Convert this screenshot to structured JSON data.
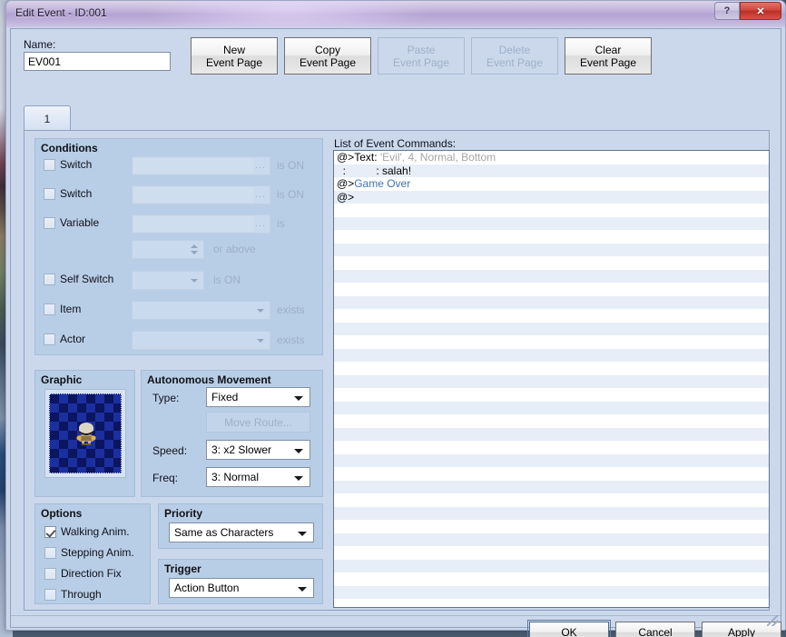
{
  "window": {
    "title": "Edit Event - ID:001",
    "help_button": "?",
    "close_button": "✕"
  },
  "header": {
    "name_label": "Name:",
    "name_value": "EV001",
    "name_placeholder": "",
    "page_buttons": [
      {
        "line1": "New",
        "line2": "Event Page",
        "enabled": true
      },
      {
        "line1": "Copy",
        "line2": "Event Page",
        "enabled": true
      },
      {
        "line1": "Paste",
        "line2": "Event Page",
        "enabled": false
      },
      {
        "line1": "Delete",
        "line2": "Event Page",
        "enabled": false
      },
      {
        "line1": "Clear",
        "line2": "Event Page",
        "enabled": true
      }
    ]
  },
  "tabs": [
    {
      "label": "1",
      "selected": true
    }
  ],
  "conditions": {
    "title": "Conditions",
    "rows": [
      {
        "label": "Switch",
        "checked": false,
        "field_value": "",
        "suffix": "is ON"
      },
      {
        "label": "Switch",
        "checked": false,
        "field_value": "",
        "suffix": "is ON"
      },
      {
        "label": "Variable",
        "checked": false,
        "field_value": "",
        "suffix": "is"
      },
      {
        "label": "",
        "checked": null,
        "field_value": "",
        "suffix": "or above"
      },
      {
        "label": "Self Switch",
        "checked": false,
        "field_value": "",
        "suffix": "is ON"
      },
      {
        "label": "Item",
        "checked": false,
        "field_value": "",
        "suffix": "exists"
      },
      {
        "label": "Actor",
        "checked": false,
        "field_value": "",
        "suffix": "exists"
      }
    ]
  },
  "graphic": {
    "title": "Graphic",
    "preview_name": "character-sprite-preview"
  },
  "movement": {
    "title": "Autonomous Movement",
    "type_label": "Type:",
    "type_value": "Fixed",
    "move_route_button": "Move Route...",
    "speed_label": "Speed:",
    "speed_value": "3: x2 Slower",
    "freq_label": "Freq:",
    "freq_value": "3: Normal"
  },
  "options": {
    "title": "Options",
    "items": [
      {
        "label": "Walking Anim.",
        "checked": true
      },
      {
        "label": "Stepping Anim.",
        "checked": false
      },
      {
        "label": "Direction Fix",
        "checked": false
      },
      {
        "label": "Through",
        "checked": false
      }
    ]
  },
  "priority": {
    "title": "Priority",
    "value": "Same as Characters"
  },
  "trigger": {
    "title": "Trigger",
    "value": "Action Button"
  },
  "commands": {
    "label": "List of Event Commands:",
    "rows": [
      {
        "prefix": "@>Text: ",
        "param": "'Evil', 4, Normal, Bottom",
        "blue": ""
      },
      {
        "prefix": "  :          : salah!",
        "param": "",
        "blue": ""
      },
      {
        "prefix": "@>",
        "param": "",
        "blue": "Game Over"
      },
      {
        "prefix": "@>",
        "param": "",
        "blue": ""
      }
    ],
    "total_visible_rows": 34
  },
  "footer": {
    "ok": "OK",
    "cancel": "Cancel",
    "apply_underline": "A",
    "apply_rest": "pply"
  },
  "colors": {
    "dialog_bg": "#cbd8ec",
    "group_bg": "#b8cee6",
    "title_gradient_top": "#c2b3dc",
    "close_red": "#d2453c",
    "link_blue": "#3f72b8",
    "param_gray": "#a5a5a5"
  }
}
